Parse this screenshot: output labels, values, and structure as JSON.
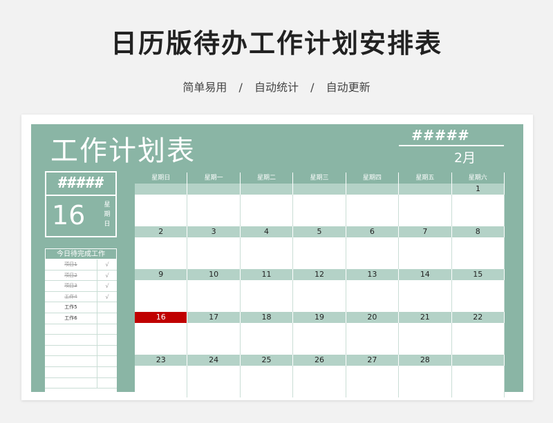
{
  "header": {
    "title": "日历版待办工作计划安排表",
    "subtitle": [
      "简单易用",
      "/",
      "自动统计",
      "/",
      "自动更新"
    ]
  },
  "sheet": {
    "title": "工作计划表",
    "hash_top": "#####",
    "month": "2月"
  },
  "left_panel": {
    "hash": "#####",
    "day": "16",
    "weekday_chars": [
      "星",
      "期",
      "日"
    ],
    "todo_header": "今日待完成工作",
    "todos": [
      {
        "task": "项目1",
        "check": "√",
        "done": true
      },
      {
        "task": "项目2",
        "check": "√",
        "done": true
      },
      {
        "task": "项目3",
        "check": "√",
        "done": true
      },
      {
        "task": "工作4",
        "check": "√",
        "done": true
      },
      {
        "task": "工作5",
        "check": "",
        "done": false
      },
      {
        "task": "工作6",
        "check": "",
        "done": false
      },
      {
        "task": "",
        "check": "",
        "done": false
      },
      {
        "task": "",
        "check": "",
        "done": false
      },
      {
        "task": "",
        "check": "",
        "done": false
      },
      {
        "task": "",
        "check": "",
        "done": false
      },
      {
        "task": "",
        "check": "",
        "done": false
      },
      {
        "task": "",
        "check": "",
        "done": false
      }
    ]
  },
  "calendar": {
    "weekdays": [
      "星期日",
      "星期一",
      "星期二",
      "星期三",
      "星期四",
      "星期五",
      "星期六"
    ],
    "weeks": [
      [
        "",
        "",
        "",
        "",
        "",
        "",
        "1"
      ],
      [
        "2",
        "3",
        "4",
        "5",
        "6",
        "7",
        "8"
      ],
      [
        "9",
        "10",
        "11",
        "12",
        "13",
        "14",
        "15"
      ],
      [
        "16",
        "17",
        "18",
        "19",
        "20",
        "21",
        "22"
      ],
      [
        "23",
        "24",
        "25",
        "26",
        "27",
        "28",
        ""
      ]
    ],
    "today": "16",
    "accent": "#8ab5a5",
    "today_color": "#c00000"
  }
}
